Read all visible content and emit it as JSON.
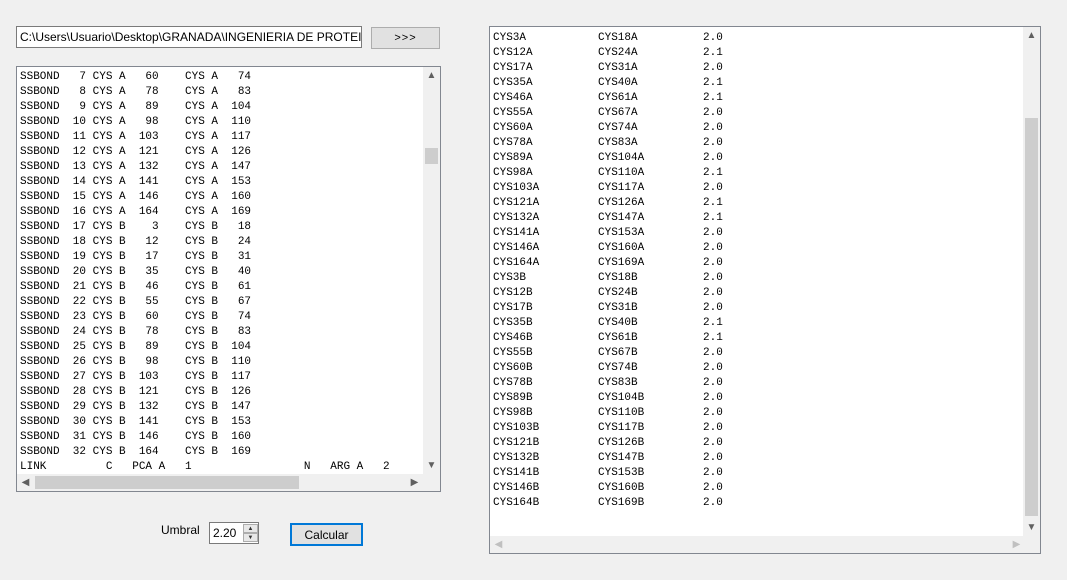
{
  "path_field": {
    "value": "C:\\Users\\Usuario\\Desktop\\GRANADA\\INGENIERIA DE PROTEINAS"
  },
  "browse_button": {
    "label": ">>>"
  },
  "pdb_text": {
    "lines": [
      "SSBOND   7 CYS A   60    CYS A   74",
      "SSBOND   8 CYS A   78    CYS A   83",
      "SSBOND   9 CYS A   89    CYS A  104",
      "SSBOND  10 CYS A   98    CYS A  110",
      "SSBOND  11 CYS A  103    CYS A  117",
      "SSBOND  12 CYS A  121    CYS A  126",
      "SSBOND  13 CYS A  132    CYS A  147",
      "SSBOND  14 CYS A  141    CYS A  153",
      "SSBOND  15 CYS A  146    CYS A  160",
      "SSBOND  16 CYS A  164    CYS A  169",
      "SSBOND  17 CYS B    3    CYS B   18",
      "SSBOND  18 CYS B   12    CYS B   24",
      "SSBOND  19 CYS B   17    CYS B   31",
      "SSBOND  20 CYS B   35    CYS B   40",
      "SSBOND  21 CYS B   46    CYS B   61",
      "SSBOND  22 CYS B   55    CYS B   67",
      "SSBOND  23 CYS B   60    CYS B   74",
      "SSBOND  24 CYS B   78    CYS B   83",
      "SSBOND  25 CYS B   89    CYS B  104",
      "SSBOND  26 CYS B   98    CYS B  110",
      "SSBOND  27 CYS B  103    CYS B  117",
      "SSBOND  28 CYS B  121    CYS B  126",
      "SSBOND  29 CYS B  132    CYS B  147",
      "SSBOND  30 CYS B  141    CYS B  153",
      "SSBOND  31 CYS B  146    CYS B  160",
      "SSBOND  32 CYS B  164    CYS B  169",
      "LINK         C   PCA A   1                 N   ARG A   2"
    ]
  },
  "umbral": {
    "label": "Umbral",
    "value": "2.20"
  },
  "calc_button": {
    "label": "Calcular"
  },
  "results": {
    "rows": [
      [
        "CYS3A",
        "CYS18A",
        "2.0"
      ],
      [
        "CYS12A",
        "CYS24A",
        "2.1"
      ],
      [
        "CYS17A",
        "CYS31A",
        "2.0"
      ],
      [
        "CYS35A",
        "CYS40A",
        "2.1"
      ],
      [
        "CYS46A",
        "CYS61A",
        "2.1"
      ],
      [
        "CYS55A",
        "CYS67A",
        "2.0"
      ],
      [
        "CYS60A",
        "CYS74A",
        "2.0"
      ],
      [
        "CYS78A",
        "CYS83A",
        "2.0"
      ],
      [
        "CYS89A",
        "CYS104A",
        "2.0"
      ],
      [
        "CYS98A",
        "CYS110A",
        "2.1"
      ],
      [
        "CYS103A",
        "CYS117A",
        "2.0"
      ],
      [
        "CYS121A",
        "CYS126A",
        "2.1"
      ],
      [
        "CYS132A",
        "CYS147A",
        "2.1"
      ],
      [
        "CYS141A",
        "CYS153A",
        "2.0"
      ],
      [
        "CYS146A",
        "CYS160A",
        "2.0"
      ],
      [
        "CYS164A",
        "CYS169A",
        "2.0"
      ],
      [
        "CYS3B",
        "CYS18B",
        "2.0"
      ],
      [
        "CYS12B",
        "CYS24B",
        "2.0"
      ],
      [
        "CYS17B",
        "CYS31B",
        "2.0"
      ],
      [
        "CYS35B",
        "CYS40B",
        "2.1"
      ],
      [
        "CYS46B",
        "CYS61B",
        "2.1"
      ],
      [
        "CYS55B",
        "CYS67B",
        "2.0"
      ],
      [
        "CYS60B",
        "CYS74B",
        "2.0"
      ],
      [
        "CYS78B",
        "CYS83B",
        "2.0"
      ],
      [
        "CYS89B",
        "CYS104B",
        "2.0"
      ],
      [
        "CYS98B",
        "CYS110B",
        "2.0"
      ],
      [
        "CYS103B",
        "CYS117B",
        "2.0"
      ],
      [
        "CYS121B",
        "CYS126B",
        "2.0"
      ],
      [
        "CYS132B",
        "CYS147B",
        "2.0"
      ],
      [
        "CYS141B",
        "CYS153B",
        "2.0"
      ],
      [
        "CYS146B",
        "CYS160B",
        "2.0"
      ],
      [
        "CYS164B",
        "CYS169B",
        "2.0"
      ]
    ]
  },
  "icons": {
    "scroll_up": "▲",
    "scroll_down": "▼",
    "scroll_left": "◀",
    "scroll_right": "▶",
    "spin_up": "▲",
    "spin_down": "▼"
  },
  "colors": {
    "window_bg": "#f0f0f0",
    "focus_border": "#0078d7",
    "scroll_thumb": "#cdcdcd"
  }
}
